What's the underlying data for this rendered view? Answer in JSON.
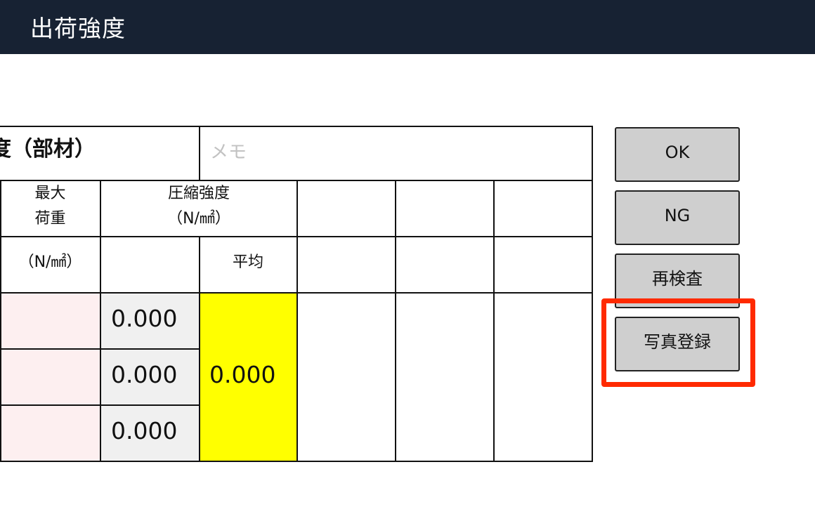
{
  "header": {
    "title": "出荷強度"
  },
  "section": {
    "title_fragment": "度（部材）",
    "memo_placeholder": "メモ"
  },
  "columns": {
    "max_load_line1": "最大",
    "max_load_line2": "荷重",
    "strength_line1": "圧縮強度",
    "strength_line2": "（N/㎟）",
    "unit": "（N/㎟）",
    "average": "平均"
  },
  "rows": [
    {
      "strength": "0.000"
    },
    {
      "strength": "0.000"
    },
    {
      "strength": "0.000"
    }
  ],
  "average_value": "0.000",
  "buttons": {
    "ok": "OK",
    "ng": "NG",
    "reinspect": "再検査",
    "photo": "写真登録"
  },
  "colors": {
    "header_bg": "#172233",
    "load_cell_bg": "#fdeff0",
    "strength_cell_bg": "#f0f0f0",
    "average_bg": "#ffff00",
    "button_bg": "#cfcfcf",
    "highlight": "#ff2a00"
  }
}
